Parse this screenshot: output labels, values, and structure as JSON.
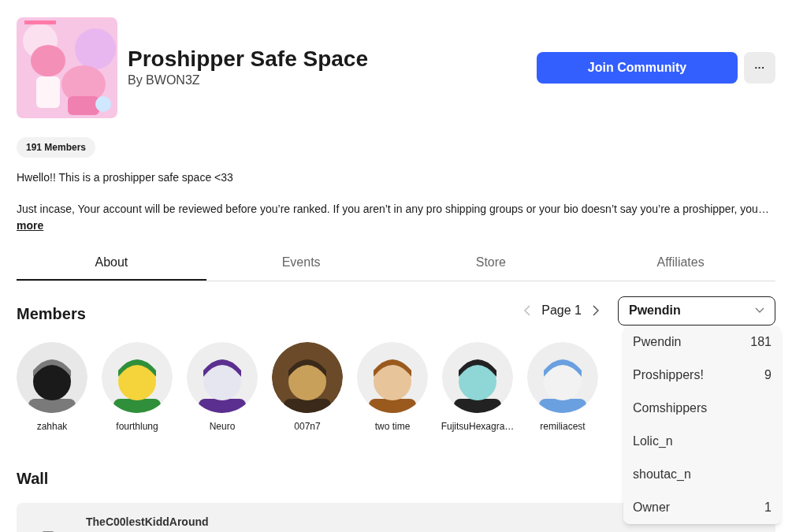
{
  "group": {
    "title": "Proshipper Safe Space",
    "owner": "By BWON3Z",
    "members_count": "191 Members",
    "description": [
      "Hwello!! This is a proshipper safe space <33",
      "Just incase, Your account will be reviewed before you’re ranked. If you aren’t in any pro shipping groups or your bio doesn’t say you’re a proshipper, you…"
    ],
    "more": "more"
  },
  "actions": {
    "join": "Join Community",
    "more": "···"
  },
  "tabs": [
    {
      "label": "About",
      "selected": true
    },
    {
      "label": "Events",
      "selected": false
    },
    {
      "label": "Store",
      "selected": false
    },
    {
      "label": "Affiliates",
      "selected": false
    }
  ],
  "members": {
    "heading": "Members",
    "page": "Page 1",
    "role_select": {
      "value": "Pwendin",
      "expanded": true,
      "options": [
        {
          "label": "Pwendin",
          "count": "181"
        },
        {
          "label": "Proshippers!",
          "count": "9"
        },
        {
          "label": "Comshippers"
        },
        {
          "label": "Lolic_n"
        },
        {
          "label": "shoutac_n"
        },
        {
          "label": "Owner",
          "count": "1"
        }
      ]
    },
    "list": [
      {
        "name": "zahhak"
      },
      {
        "name": "fourthlung"
      },
      {
        "name": "Neuro"
      },
      {
        "name": "007n7"
      },
      {
        "name": "two time"
      },
      {
        "name": "FujitsuHexagra…"
      },
      {
        "name": "remiliacest"
      }
    ]
  },
  "wall": {
    "heading": "Wall",
    "posts": [
      {
        "author": "TheC00lestKiddAround"
      }
    ]
  }
}
